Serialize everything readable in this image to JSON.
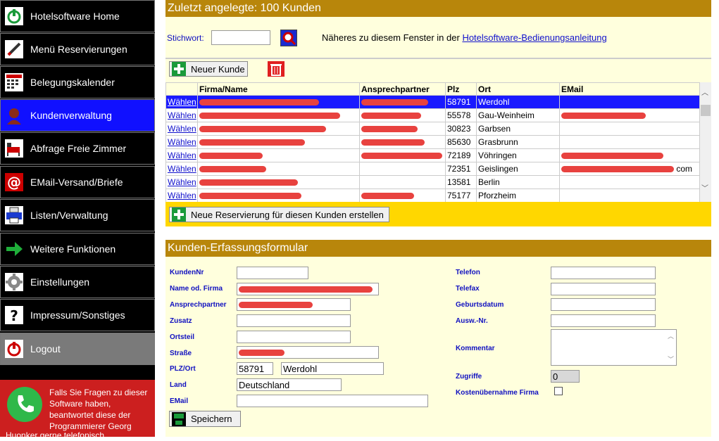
{
  "sidebar": {
    "items": [
      {
        "label": "Hotelsoftware Home",
        "icon": "power-icon"
      },
      {
        "label": "Menü Reservierungen",
        "icon": "pencil-icon"
      },
      {
        "label": "Belegungskalender",
        "icon": "calendar-icon"
      },
      {
        "label": "Kundenverwaltung",
        "icon": "person-icon"
      },
      {
        "label": "Abfrage Freie Zimmer",
        "icon": "room-icon"
      },
      {
        "label": "EMail-Versand/Briefe",
        "icon": "at-icon"
      },
      {
        "label": "Listen/Verwaltung",
        "icon": "printer-icon"
      },
      {
        "label": "Weitere Funktionen",
        "icon": "arrow-right-icon"
      },
      {
        "label": "Einstellungen",
        "icon": "gear-icon"
      },
      {
        "label": "Impressum/Sonstiges",
        "icon": "question-icon"
      },
      {
        "label": "Logout",
        "icon": "power-icon"
      }
    ],
    "help_text": "Falls Sie Fragen zu dieser Software haben, beantwortet diese der Programmierer Georg",
    "help_text_tail": "Huonker gerne telefonisch"
  },
  "customers": {
    "header": "Zuletzt angelegte: 100 Kunden",
    "search_label": "Stichwort:",
    "search_value": "",
    "info_text": "Näheres zu diesem Fenster in der ",
    "info_link": "Hotelsoftware-Bedienungsanleitung",
    "new_customer_label": "Neuer Kunde",
    "columns": [
      "",
      "Firma/Name",
      "Ansprechpartner",
      "Plz",
      "Ort",
      "EMail"
    ],
    "select_label": "Wählen",
    "rows": [
      {
        "plz": "58791",
        "ort": "Werdohl",
        "email": ""
      },
      {
        "plz": "55578",
        "ort": "Gau-Weinheim",
        "email": ""
      },
      {
        "plz": "30823",
        "ort": "Garbsen",
        "email": ""
      },
      {
        "plz": "85630",
        "ort": "Grasbrunn",
        "email": ""
      },
      {
        "plz": "72189",
        "ort": "Vöhringen",
        "email": ""
      },
      {
        "plz": "72351",
        "ort": "Geislingen",
        "email": "com"
      },
      {
        "plz": "13581",
        "ort": "Berlin",
        "email": ""
      },
      {
        "plz": "75177",
        "ort": "Pforzheim",
        "email": ""
      }
    ],
    "reserve_label": "Neue Reservierung für diesen Kunden erstellen"
  },
  "form": {
    "header": "Kunden-Erfassungsformular",
    "labels": {
      "kundennr": "KundenNr",
      "name": "Name od. Firma",
      "ansprechpartner": "Ansprechpartner",
      "zusatz": "Zusatz",
      "ortsteil": "Ortsteil",
      "strasse": "Straße",
      "plzort": "PLZ/Ort",
      "land": "Land",
      "email": "EMail",
      "telefon": "Telefon",
      "telefax": "Telefax",
      "geburtsdatum": "Geburtsdatum",
      "ausw": "Ausw.-Nr.",
      "kommentar": "Kommentar",
      "zugriffe": "Zugriffe",
      "kosten": "Kostenübernahme Firma"
    },
    "values": {
      "plz": "58791",
      "ort": "Werdohl",
      "land": "Deutschland",
      "zugriffe": "0"
    },
    "save_label": "Speichern"
  },
  "colors": {
    "header_bg": "#b8860b",
    "panel_bg": "#ffffdd",
    "active_nav": "#1010ff",
    "reserve_bar": "#ffd700",
    "help_bg": "#cc1f1f"
  }
}
